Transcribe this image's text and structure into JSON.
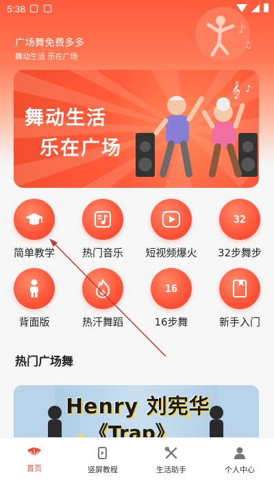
{
  "status_bar": {
    "time": "5:38"
  },
  "header": {
    "title": "广场舞免费多多",
    "subtitle": "舞动生活 乐在广场"
  },
  "banner": {
    "line1": "舞动生活",
    "line2": "乐在广场"
  },
  "grid": {
    "items": [
      {
        "label": "简单教学",
        "icon": "graduation-cap-icon"
      },
      {
        "label": "热门音乐",
        "icon": "music-note-icon"
      },
      {
        "label": "短视频爆火",
        "icon": "play-icon"
      },
      {
        "label": "32步舞步",
        "icon": "number-32-icon",
        "badge": "32"
      },
      {
        "label": "背面版",
        "icon": "person-icon"
      },
      {
        "label": "热汗舞蹈",
        "icon": "flame-icon"
      },
      {
        "label": "16步舞",
        "icon": "number-16-icon",
        "badge": "16"
      },
      {
        "label": "新手入门",
        "icon": "book-icon"
      }
    ]
  },
  "section": {
    "title": "热门广场舞"
  },
  "video_card": {
    "title_line1": "Henry 刘宪华",
    "title_line2": "《Trap》"
  },
  "tabbar": {
    "items": [
      {
        "label": "首页",
        "icon": "home-fan-icon",
        "active": true
      },
      {
        "label": "竖屏教程",
        "icon": "phone-rotate-icon",
        "active": false
      },
      {
        "label": "生活助手",
        "icon": "tools-icon",
        "active": false
      },
      {
        "label": "个人中心",
        "icon": "user-icon",
        "active": false
      }
    ]
  },
  "colors": {
    "accent": "#f04b2e",
    "header_top": "#ff5a3c",
    "text": "#222222"
  }
}
